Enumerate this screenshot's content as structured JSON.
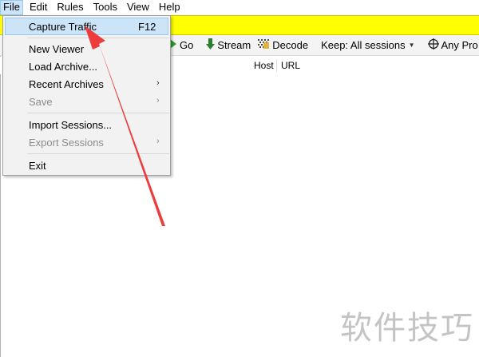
{
  "menubar": {
    "items": [
      "File",
      "Edit",
      "Rules",
      "Tools",
      "View",
      "Help"
    ]
  },
  "toolbar": {
    "go_label": "Go",
    "stream_label": "Stream",
    "decode_label": "Decode",
    "keep_label": "Keep: All sessions",
    "process_label": "Any Pro"
  },
  "columns": {
    "host": "Host",
    "url": "URL"
  },
  "file_menu": {
    "items": [
      {
        "label": "Capture Traffic",
        "shortcut": "F12",
        "enabled": true,
        "highlighted": true
      },
      {
        "label": "New Viewer",
        "enabled": true
      },
      {
        "label": "Load Archive...",
        "enabled": true
      },
      {
        "label": "Recent Archives",
        "enabled": true,
        "submenu": true
      },
      {
        "label": "Save",
        "enabled": false,
        "submenu": true
      },
      {
        "label": "Import Sessions...",
        "enabled": true
      },
      {
        "label": "Export Sessions",
        "enabled": false,
        "submenu": true
      },
      {
        "label": "Exit",
        "enabled": true
      }
    ]
  },
  "colors": {
    "yellow_bar": "#ffff00",
    "menu_highlight": "#cce4f7",
    "annotation_arrow": "#ee3b3b",
    "go_icon": "#2e9d2e",
    "stream_icon": "#2e7d32"
  },
  "watermark": "软件技巧"
}
